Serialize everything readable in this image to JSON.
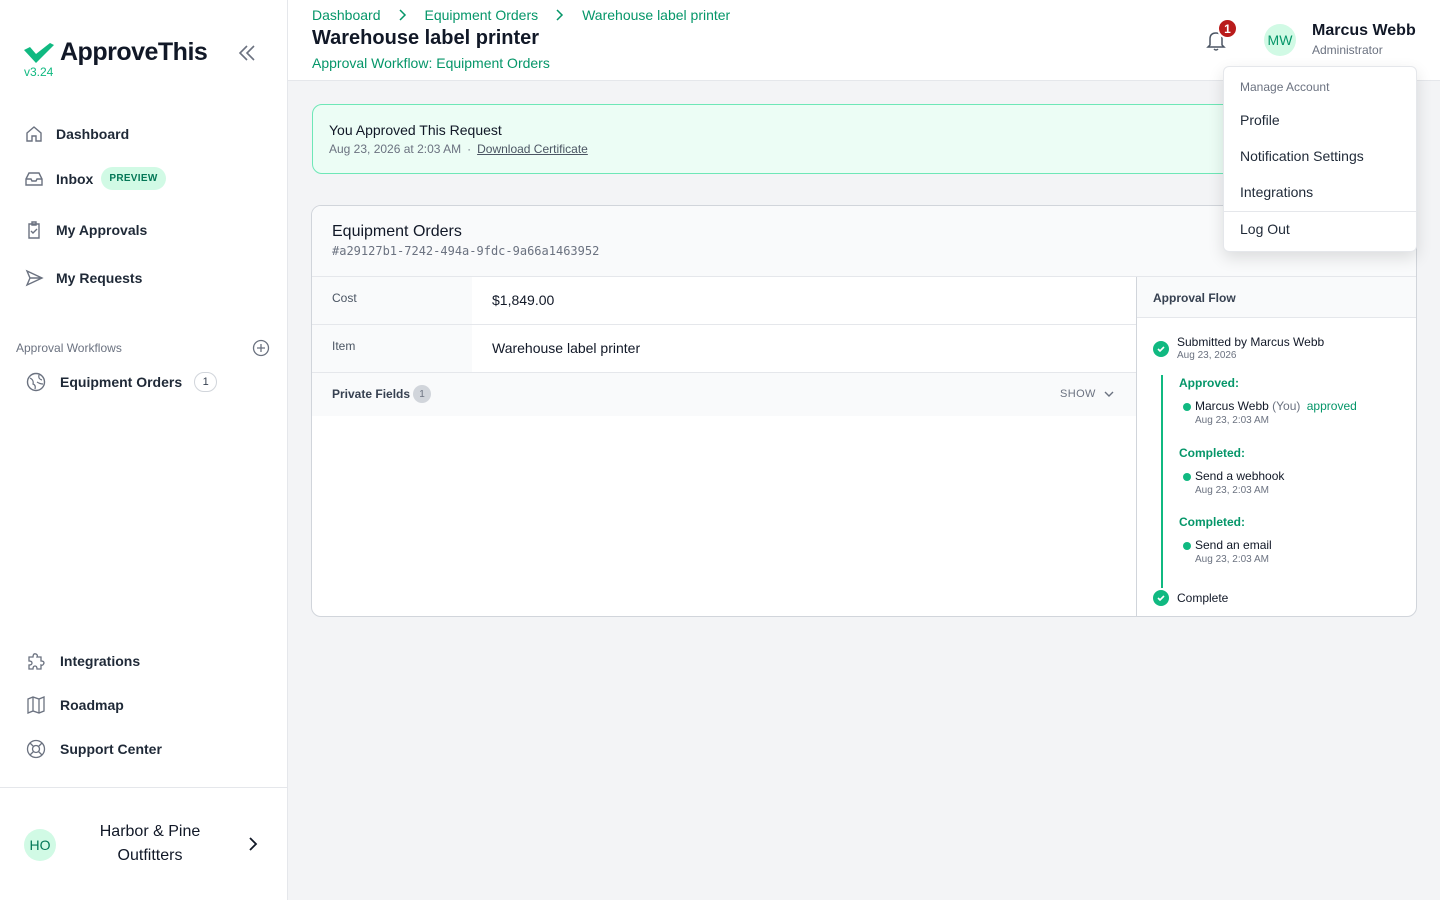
{
  "app": {
    "name": "ApproveThis",
    "version": "v3.24"
  },
  "colors": {
    "accent": "#10b981",
    "accent_dark": "#059669",
    "badge_red": "#b91c1c",
    "success_bg": "#ecfdf5"
  },
  "sidebar": {
    "nav": [
      {
        "label": "Dashboard",
        "icon": "home-icon"
      },
      {
        "label": "Inbox",
        "icon": "inbox-icon",
        "badge": "PREVIEW"
      },
      {
        "label": "My Approvals",
        "icon": "clipboard-check-icon"
      },
      {
        "label": "My Requests",
        "icon": "send-icon"
      }
    ],
    "workflows_label": "Approval Workflows",
    "workflows": [
      {
        "label": "Equipment Orders",
        "icon": "globe-icon",
        "count": "1"
      }
    ],
    "bottom_nav": [
      {
        "label": "Integrations",
        "icon": "puzzle-icon"
      },
      {
        "label": "Roadmap",
        "icon": "map-icon"
      },
      {
        "label": "Support Center",
        "icon": "lifebuoy-icon"
      }
    ],
    "org": {
      "initials": "HO",
      "name": "Harbor & Pine Outfitters"
    }
  },
  "header": {
    "breadcrumbs": [
      "Dashboard",
      "Equipment Orders",
      "Warehouse label printer"
    ],
    "title": "Warehouse label printer",
    "subtitle": "Approval Workflow: Equipment Orders",
    "notification_count": "1",
    "user": {
      "initials": "MW",
      "name": "Marcus Webb",
      "role": "Administrator"
    }
  },
  "alert": {
    "title": "You Approved This Request",
    "timestamp": "Aug 23, 2026 at 2:03 AM",
    "separator": "·",
    "link": "Download Certificate"
  },
  "request": {
    "workflow": "Equipment Orders",
    "id": "#a29127b1-7242-494a-9fdc-9a66a1463952",
    "fields": [
      {
        "label": "Cost",
        "value": "$1,849.00"
      },
      {
        "label": "Item",
        "value": "Warehouse label printer"
      }
    ],
    "private_fields": {
      "label": "Private Fields",
      "count": "1",
      "toggle": "SHOW"
    }
  },
  "flow": {
    "title": "Approval Flow",
    "submitted": {
      "text": "Submitted by Marcus Webb",
      "time": "Aug 23, 2026"
    },
    "groups": [
      {
        "label": "Approved:",
        "name": "Marcus Webb",
        "you": "(You)",
        "status": "approved",
        "time": "Aug 23, 2:03 AM"
      },
      {
        "label": "Completed:",
        "name": "Send a webhook",
        "time": "Aug 23, 2:03 AM"
      },
      {
        "label": "Completed:",
        "name": "Send an email",
        "time": "Aug 23, 2:03 AM"
      }
    ],
    "complete": "Complete"
  },
  "account_menu": {
    "header": "Manage Account",
    "items": [
      "Profile",
      "Notification Settings",
      "Integrations"
    ],
    "logout": "Log Out"
  }
}
